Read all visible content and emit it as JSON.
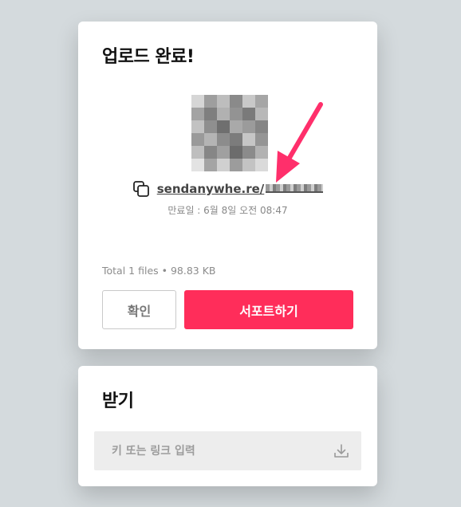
{
  "upload": {
    "title": "업로드 완료!",
    "link_text": "sendanywhe.re/",
    "expiry": "만료일 : 6월 8일 오전 08:47",
    "file_info": "Total 1 files • 98.83 KB",
    "confirm_label": "확인",
    "support_label": "서포트하기"
  },
  "receive": {
    "title": "받기",
    "key_placeholder": "키 또는 링크 입력"
  },
  "icons": {
    "copy": "copy-icon",
    "download": "download-icon",
    "qr": "qr-code"
  },
  "colors": {
    "accent": "#ff2d5a",
    "annotation_arrow": "#ff2f6b",
    "background": "#d4dadd",
    "card": "#ffffff",
    "input_bg": "#ededed"
  }
}
